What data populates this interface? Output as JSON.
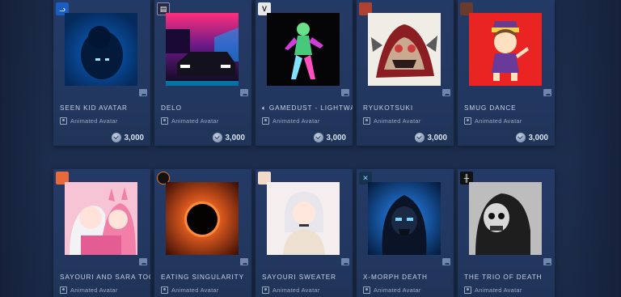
{
  "items": [
    {
      "title": "SEEN KID AVATAR",
      "subtitle": "Animated Avatar",
      "price": "3,000",
      "icon": "game-icon-seen",
      "accent": "#2d6cc9"
    },
    {
      "title": "DELO",
      "subtitle": "Animated Avatar",
      "price": "3,000",
      "icon": "game-icon-delo",
      "accent": "#c5276f"
    },
    {
      "title": "GAMEDUST - LIGHTWA",
      "subtitle": "Animated Avatar",
      "price": "3,000",
      "icon": "game-icon-gamedust",
      "accent": "#3fbf74"
    },
    {
      "title": "RYUKOTSUKI",
      "subtitle": "Animated Avatar",
      "price": "3,000",
      "icon": "game-icon-ryukotsuki",
      "accent": "#c94a3a"
    },
    {
      "title": "SMUG DANCE",
      "subtitle": "Animated Avatar",
      "price": "3,000",
      "icon": "game-icon-smug",
      "accent": "#e22b2b"
    },
    {
      "title": "SAYOURI AND SARA TOGE",
      "subtitle": "Animated Avatar",
      "price": "",
      "icon": "game-icon-sayouri",
      "accent": "#f4a8c2"
    },
    {
      "title": "EATING SINGULARITY",
      "subtitle": "Animated Avatar",
      "price": "",
      "icon": "game-icon-singularity",
      "accent": "#d9531e"
    },
    {
      "title": "SAYOURI SWEATER",
      "subtitle": "Animated Avatar",
      "price": "",
      "icon": "game-icon-sayouri-2",
      "accent": "#e9d6ce"
    },
    {
      "title": "X-MORPH DEATH",
      "subtitle": "Animated Avatar",
      "price": "",
      "icon": "game-icon-xmorph",
      "accent": "#2a7de1"
    },
    {
      "title": "THE TRIO OF DEATH",
      "subtitle": "Animated Avatar",
      "price": "",
      "icon": "game-icon-trio",
      "accent": "#9a9a9a"
    }
  ],
  "icon_labels": {
    "seen": "ᓗ",
    "delo": "▤",
    "gamedust": "V",
    "trio": "╫",
    "xmorph": "✕"
  }
}
